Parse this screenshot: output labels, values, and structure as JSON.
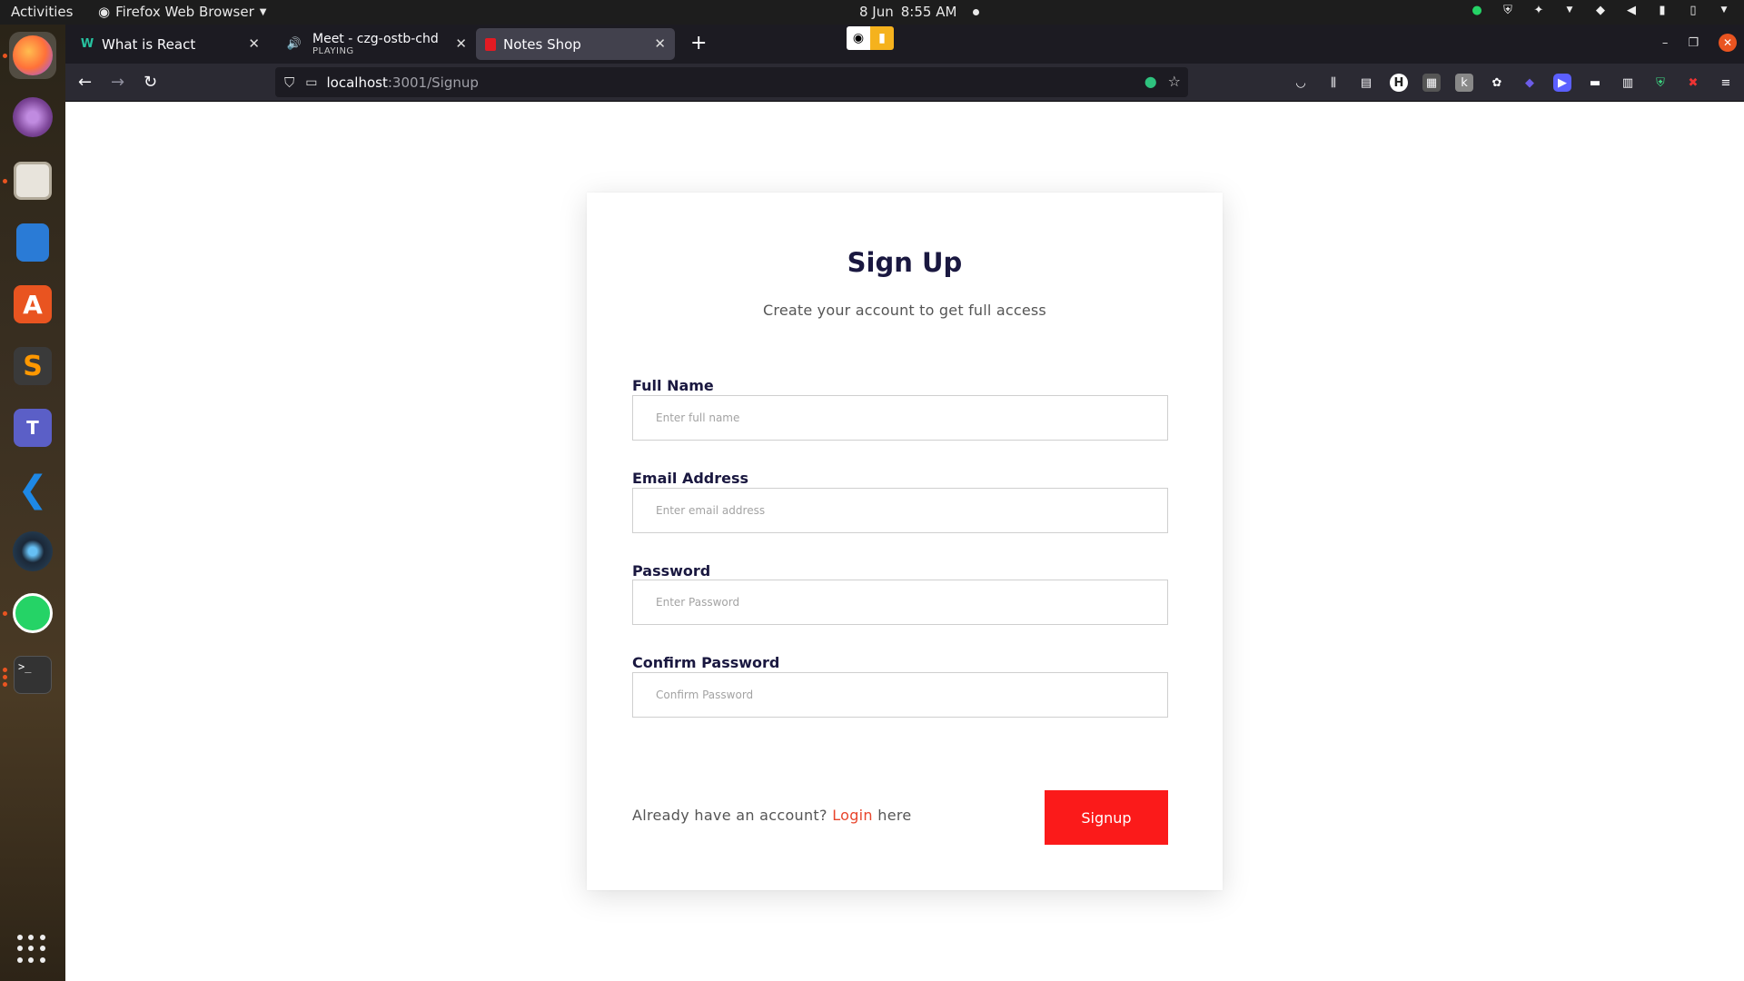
{
  "system_bar": {
    "activities": "Activities",
    "app_name": "Firefox Web Browser",
    "date": "8 Jun",
    "time": "8:55 AM"
  },
  "dock": {
    "items": [
      {
        "name": "Firefox",
        "icon": "firefox-icon",
        "color": "#ff7139"
      },
      {
        "name": "Tor Browser",
        "icon": "tor-icon",
        "color": "#7d4698"
      },
      {
        "name": "Files",
        "icon": "files-icon",
        "color": "#c8c1b3"
      },
      {
        "name": "LibreOffice Writer",
        "icon": "writer-icon",
        "color": "#2a7bd6"
      },
      {
        "name": "Ubuntu Software",
        "icon": "software-icon",
        "color": "#e95420"
      },
      {
        "name": "Sublime Text",
        "icon": "sublime-icon",
        "color": "#ff9800"
      },
      {
        "name": "Teams",
        "icon": "teams-icon",
        "color": "#5b5fc7"
      },
      {
        "name": "VS Code",
        "icon": "vscode-icon",
        "color": "#1e88e5"
      },
      {
        "name": "Steam",
        "icon": "steam-icon",
        "color": "#1b2838"
      },
      {
        "name": "WhatsApp",
        "icon": "whatsapp-icon",
        "color": "#25d366"
      },
      {
        "name": "Terminal",
        "icon": "terminal-icon",
        "color": "#333333"
      }
    ]
  },
  "browser": {
    "tabs": [
      {
        "title": "What is React",
        "subtitle": "",
        "favicon": "W"
      },
      {
        "title": "Meet - czg-ostb-chd",
        "subtitle": "PLAYING",
        "favicon": ""
      },
      {
        "title": "Notes Shop",
        "subtitle": "",
        "favicon": ""
      }
    ],
    "url_host": "localhost",
    "url_path": ":3001/Signup"
  },
  "form": {
    "title": "Sign Up",
    "subtitle": "Create your account to get full access",
    "fields": [
      {
        "label": "Full Name",
        "placeholder": "Enter full name",
        "value": ""
      },
      {
        "label": "Email Address",
        "placeholder": "Enter email address",
        "value": ""
      },
      {
        "label": "Password",
        "placeholder": "Enter Password",
        "value": ""
      },
      {
        "label": "Confirm Password",
        "placeholder": "Confirm Password",
        "value": ""
      }
    ],
    "already_text": "Already have an account?",
    "login_link": "Login",
    "here_text": "here",
    "submit_label": "Signup"
  },
  "colors": {
    "accent": "#fb1a1a",
    "heading": "#1a1840",
    "link": "#e8452c"
  }
}
